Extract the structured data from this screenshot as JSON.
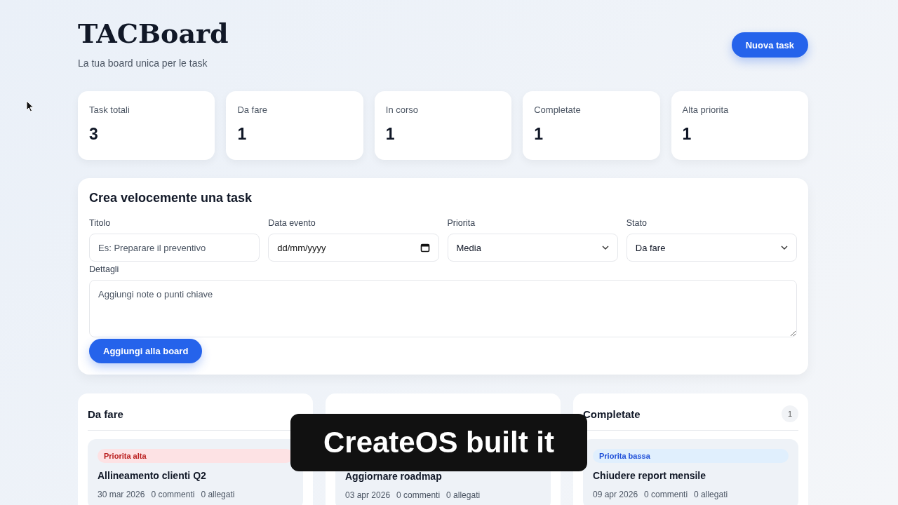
{
  "header": {
    "title": "TACBoard",
    "subtitle": "La tua board unica per le task",
    "action": "Nuova task"
  },
  "stats": [
    {
      "label": "Task totali",
      "value": "3"
    },
    {
      "label": "Da fare",
      "value": "1"
    },
    {
      "label": "In corso",
      "value": "1"
    },
    {
      "label": "Completate",
      "value": "1"
    },
    {
      "label": "Alta priorita",
      "value": "1"
    }
  ],
  "form": {
    "title": "Crea velocemente una task",
    "fields": [
      {
        "kind": "text",
        "label": "Titolo",
        "placeholder": "Es: Preparare il preventivo"
      },
      {
        "kind": "date",
        "label": "Data evento",
        "placeholder": "dd/mm/yyyy"
      },
      {
        "kind": "select",
        "label": "Priorita",
        "value": "Media"
      },
      {
        "kind": "select",
        "label": "Stato",
        "value": "Da fare"
      }
    ],
    "details": {
      "label": "Dettagli",
      "placeholder": "Aggiungi note o punti chiave"
    },
    "submit": "Aggiungi alla board"
  },
  "columns": [
    {
      "title": "Da fare",
      "tasks": [
        {
          "badge": {
            "label": "Priorita alta",
            "kind": "high"
          },
          "title": "Allineamento clienti Q2",
          "date": "30 mar 2026",
          "comments": "0 commenti",
          "attachments": "0 allegati"
        }
      ]
    },
    {
      "tasks": [
        {
          "title": "Aggiornare roadmap",
          "date": "03 apr 2026",
          "comments": "0 commenti",
          "attachments": "0 allegati"
        }
      ]
    },
    {
      "title": "Completate",
      "count": "1",
      "tasks": [
        {
          "badge": {
            "label": "Priorita bassa",
            "kind": "low"
          },
          "title": "Chiudere report mensile",
          "date": "09 apr 2026",
          "comments": "0 commenti",
          "attachments": "0 allegati"
        }
      ]
    }
  ],
  "caption": "CreateOS built it"
}
